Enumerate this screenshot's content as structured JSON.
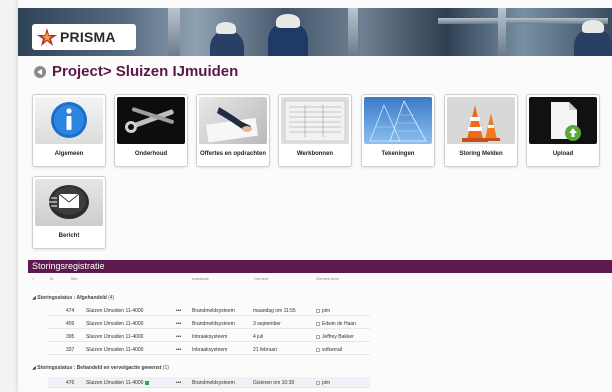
{
  "header": {
    "logo_text": "PRISMA"
  },
  "page_title": "Project> Sluizen IJmuiden",
  "tiles": [
    {
      "label": "Algemeen",
      "icon": "info-icon"
    },
    {
      "label": "Onderhoud",
      "icon": "wrench-icon"
    },
    {
      "label": "Offertes en opdrachten",
      "icon": "handshake-icon"
    },
    {
      "label": "Werkbonnen",
      "icon": "document-icon"
    },
    {
      "label": "Tekeningen",
      "icon": "building-icon"
    },
    {
      "label": "Storing Melden",
      "icon": "traffic-cone-icon"
    },
    {
      "label": "Upload",
      "icon": "upload-icon"
    },
    {
      "label": "Bericht",
      "icon": "envelope-icon"
    }
  ],
  "section": {
    "title": "Storingsregistratie",
    "columns": [
      "Id",
      "Titel",
      "Installatie",
      "Gemeld",
      "Gemeld door"
    ],
    "groups": [
      {
        "label": "Storingsstatus : Afgehandeld",
        "count": "(4)",
        "rows": [
          {
            "id": "474",
            "title": "Sluizen IJmuiden 11-4000",
            "more": "•••",
            "installatie": "Brandmeldsysteem",
            "gemeld": "maandag om 11:55",
            "door": "pim"
          },
          {
            "id": "409",
            "title": "Sluizen IJmuiden 11-4000",
            "more": "•••",
            "installatie": "Brandmeldsysteem",
            "gemeld": "3 september",
            "door": "Edwin de Haan"
          },
          {
            "id": "395",
            "title": "Sluizen IJmuiden 11-4000",
            "more": "•••",
            "installatie": "Inbraaksysteem",
            "gemeld": "4 juli",
            "door": "Jeffrey Bakker"
          },
          {
            "id": "337",
            "title": "Sluizen IJmuiden 11-4000",
            "more": "•••",
            "installatie": "Inbraaksysteem",
            "gemeld": "21 februari",
            "door": "volkerrail"
          }
        ]
      },
      {
        "label": "Storingsstatus : Behandeld en vervolgactie gewenst",
        "count": "(1)",
        "rows": [
          {
            "id": "476",
            "title": "Sluizen IJmuiden 11-4000",
            "more": "•••",
            "installatie": "Brandmeldsysteem",
            "gemeld": "Gisteren om 10:39",
            "door": "pim"
          }
        ]
      }
    ]
  },
  "colors": {
    "accent": "#5d1a4f",
    "title": "#5a1846"
  }
}
